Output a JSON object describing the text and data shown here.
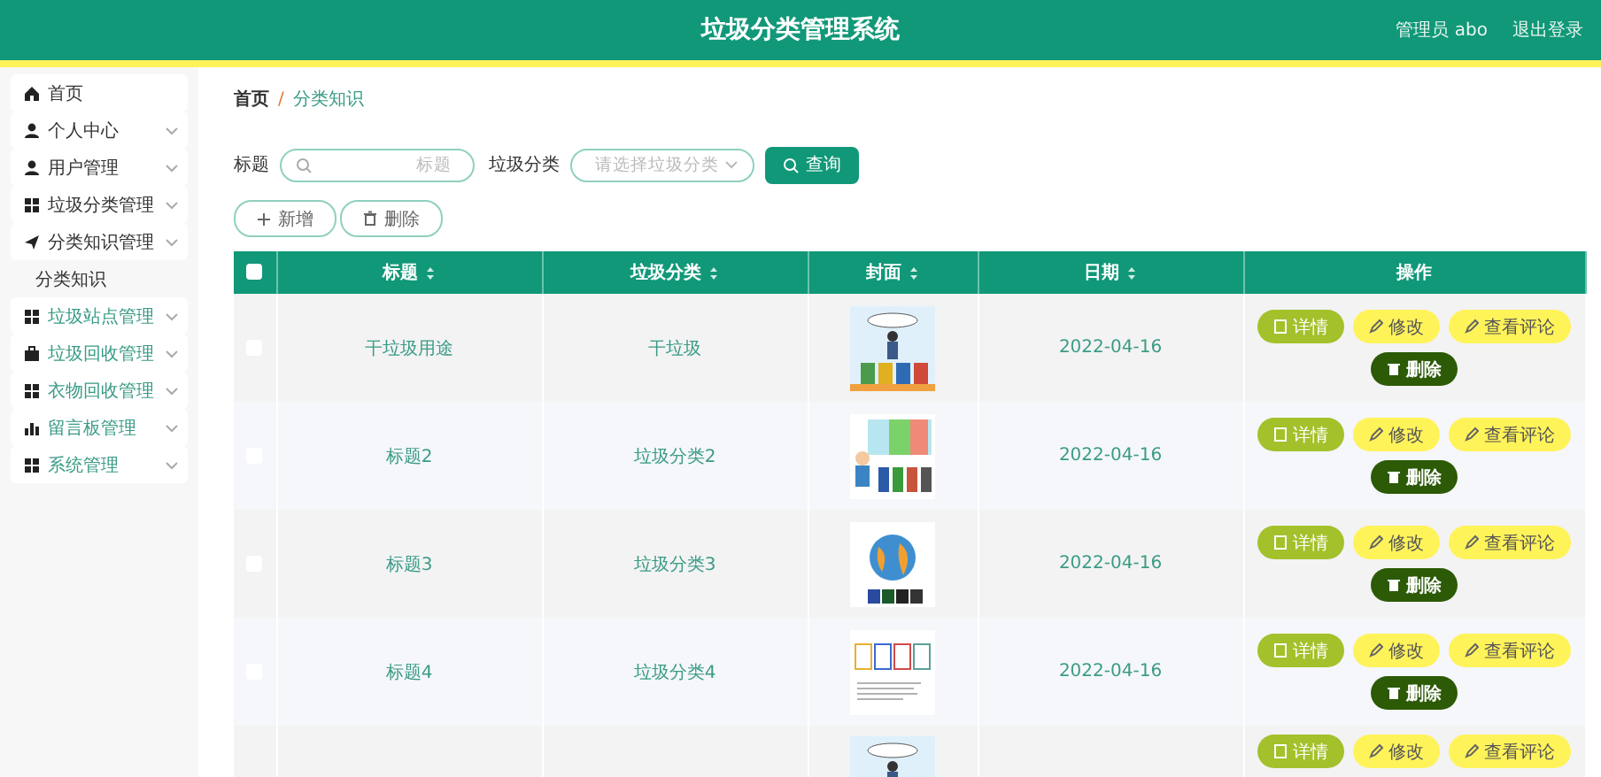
{
  "header": {
    "title": "垃圾分类管理系统",
    "user": "管理员 abo",
    "logout": "退出登录"
  },
  "sidebar": {
    "items": [
      {
        "kind": "menu",
        "label": "首页",
        "expandable": false
      },
      {
        "kind": "menu",
        "label": "个人中心",
        "expandable": true
      },
      {
        "kind": "menu",
        "label": "用户管理",
        "expandable": true
      },
      {
        "kind": "menu",
        "label": "垃圾分类管理",
        "expandable": true
      },
      {
        "kind": "menu",
        "label": "分类知识管理",
        "expandable": true
      },
      {
        "kind": "sub",
        "label": "分类知识"
      },
      {
        "kind": "menu",
        "label": "垃圾站点管理",
        "expandable": true
      },
      {
        "kind": "menu",
        "label": "垃圾回收管理",
        "expandable": true
      },
      {
        "kind": "menu",
        "label": "衣物回收管理",
        "expandable": true
      },
      {
        "kind": "menu",
        "label": "留言板管理",
        "expandable": true
      },
      {
        "kind": "menu",
        "label": "系统管理",
        "expandable": true
      }
    ]
  },
  "breadcrumb": [
    "首页",
    "/",
    "分类知识"
  ],
  "filters": {
    "title_label": "标题",
    "title_placeholder": "标题",
    "category_label": "垃圾分类",
    "category_placeholder": "请选择垃圾分类",
    "search_button": "查询"
  },
  "actions": [
    "新增",
    "删除"
  ],
  "table": {
    "select_all_checked": false,
    "columns": [
      {
        "label": "标题",
        "sortable": true
      },
      {
        "label": "垃圾分类",
        "sortable": true
      },
      {
        "label": "封面",
        "sortable": true
      },
      {
        "label": "日期",
        "sortable": true
      },
      {
        "label": "操作",
        "sortable": false
      }
    ],
    "rows": [
      {
        "checked": false,
        "title": "干垃圾用途",
        "category": "干垃圾",
        "date": "2022-04-16",
        "buttons": [
          {
            "kind": "detail",
            "label": "详情"
          },
          {
            "kind": "edit",
            "label": "修改"
          },
          {
            "kind": "edit",
            "label": "查看评论"
          },
          {
            "kind": "delete",
            "label": "删除"
          }
        ]
      },
      {
        "checked": false,
        "title": "标题2",
        "category": "垃圾分类2",
        "date": "2022-04-16",
        "buttons": [
          {
            "kind": "detail",
            "label": "详情"
          },
          {
            "kind": "edit",
            "label": "修改"
          },
          {
            "kind": "edit",
            "label": "查看评论"
          },
          {
            "kind": "delete",
            "label": "删除"
          }
        ]
      },
      {
        "checked": false,
        "title": "标题3",
        "category": "垃圾分类3",
        "date": "2022-04-16",
        "buttons": [
          {
            "kind": "detail",
            "label": "详情"
          },
          {
            "kind": "edit",
            "label": "修改"
          },
          {
            "kind": "edit",
            "label": "查看评论"
          },
          {
            "kind": "delete",
            "label": "删除"
          }
        ]
      },
      {
        "checked": false,
        "title": "标题4",
        "category": "垃圾分类4",
        "date": "2022-04-16",
        "buttons": [
          {
            "kind": "detail",
            "label": "详情"
          },
          {
            "kind": "edit",
            "label": "修改"
          },
          {
            "kind": "edit",
            "label": "查看评论"
          },
          {
            "kind": "delete",
            "label": "删除"
          }
        ]
      },
      {
        "buttons": [
          {
            "kind": "detail",
            "label": "详情"
          },
          {
            "kind": "edit",
            "label": "修改"
          },
          {
            "kind": "edit",
            "label": "查看评论"
          }
        ]
      }
    ]
  }
}
